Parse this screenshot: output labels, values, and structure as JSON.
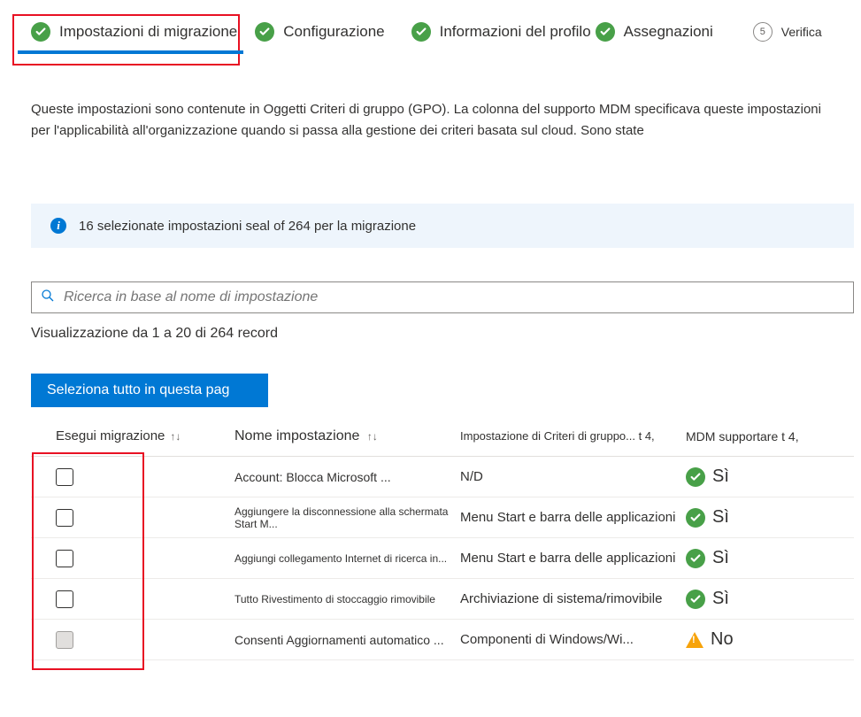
{
  "stepper": {
    "steps": [
      {
        "label": "Impostazioni di migrazione",
        "done": true,
        "active": true
      },
      {
        "label": "Configurazione",
        "done": true
      },
      {
        "label": "Informazioni del profilo",
        "done": true
      },
      {
        "label": "Assegnazioni",
        "done": true
      },
      {
        "label": "Verifica",
        "number": "5"
      }
    ]
  },
  "description": "Queste impostazioni sono contenute in Oggetti Criteri di gruppo (GPO). La colonna del supporto MDM specificava queste impostazioni per l'applicabilità all'organizzazione quando si passa alla gestione dei criteri basata sul cloud. Sono state",
  "banner": {
    "text": "16 selezionate impostazioni seal of 264 per la migrazione"
  },
  "search": {
    "placeholder": "Ricerca in base al nome di impostazione"
  },
  "viewing": "Visualizzazione da 1 a 20 di 264 record",
  "selectAll": "Seleziona tutto in questa pag",
  "columns": {
    "migrate": "Esegui migrazione",
    "name": "Nome impostazione",
    "gpo": "Impostazione di Criteri di gruppo... t 4,",
    "mdm": "MDM supportare t 4,"
  },
  "rows": [
    {
      "name": "Account: Blocca Microsoft ...",
      "gpo": "N/D",
      "mdm": "Sì",
      "mdmOk": true,
      "small": false,
      "disabled": false
    },
    {
      "name": "Aggiungere la disconnessione alla schermata Start M...",
      "gpo": "Menu Start e barra delle applicazioni",
      "mdm": "Sì",
      "mdmOk": true,
      "small": true,
      "disabled": false
    },
    {
      "name": "Aggiungi collegamento Internet di ricerca in...",
      "gpo": "Menu Start e barra delle applicazioni",
      "mdm": "Sì",
      "mdmOk": true,
      "small": true,
      "disabled": false
    },
    {
      "name": "Tutto Rivestimento di stoccaggio rimovibile",
      "gpo": "Archiviazione di sistema/rimovibile",
      "mdm": "Sì",
      "mdmOk": true,
      "small": true,
      "disabled": false
    },
    {
      "name": "Consenti Aggiornamenti automatico ...",
      "gpo": "Componenti di Windows/Wi...",
      "mdm": "No",
      "mdmOk": false,
      "small": false,
      "disabled": true
    }
  ]
}
